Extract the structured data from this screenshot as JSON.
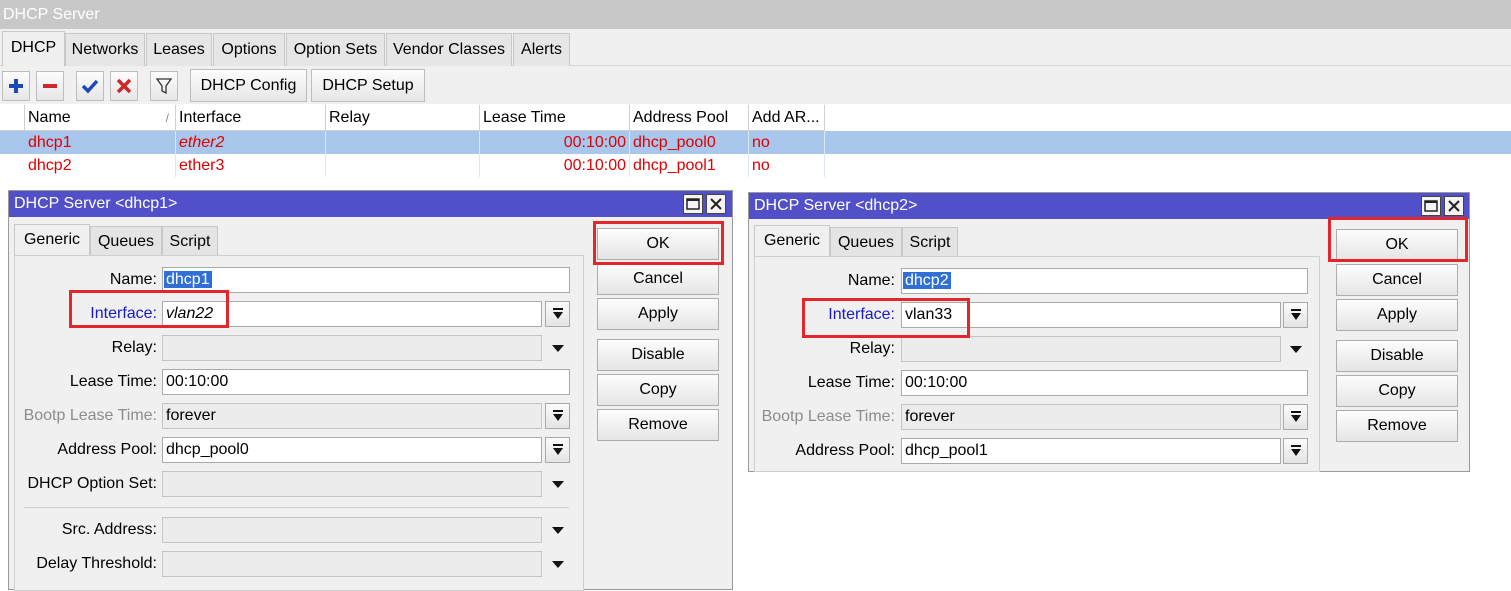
{
  "window": {
    "title": "DHCP Server"
  },
  "tabs": [
    "DHCP",
    "Networks",
    "Leases",
    "Options",
    "Option Sets",
    "Vendor Classes",
    "Alerts"
  ],
  "toolbar": {
    "dhcp_config": "DHCP Config",
    "dhcp_setup": "DHCP Setup",
    "icons": [
      "add-icon",
      "remove-icon",
      "enable-check-icon",
      "disable-x-icon",
      "filter-icon"
    ]
  },
  "table": {
    "columns": [
      "Name",
      "Interface",
      "Relay",
      "Lease Time",
      "Address Pool",
      "Add AR..."
    ],
    "rows": [
      {
        "name": "dhcp1",
        "interface": "ether2",
        "relay": "",
        "lease_time": "00:10:00",
        "address_pool": "dhcp_pool0",
        "add_arp": "no",
        "selected": true
      },
      {
        "name": "dhcp2",
        "interface": "ether3",
        "relay": "",
        "lease_time": "00:10:00",
        "address_pool": "dhcp_pool1",
        "add_arp": "no",
        "selected": false
      }
    ]
  },
  "dialogs": [
    {
      "title": "DHCP Server <dhcp1>",
      "tabs": [
        "Generic",
        "Queues",
        "Script"
      ],
      "labels": {
        "name": "Name:",
        "interface": "Interface:",
        "relay": "Relay:",
        "lease_time": "Lease Time:",
        "bootp": "Bootp Lease Time:",
        "address_pool": "Address Pool:",
        "option_set": "DHCP Option Set:",
        "src_address": "Src. Address:",
        "delay": "Delay Threshold:"
      },
      "values": {
        "name": "dhcp1",
        "interface": "vlan22",
        "relay": "",
        "lease_time": "00:10:00",
        "bootp": "forever",
        "address_pool": "dhcp_pool0",
        "option_set": "",
        "src_address": "",
        "delay": ""
      },
      "buttons": [
        "OK",
        "Cancel",
        "Apply",
        "Disable",
        "Copy",
        "Remove"
      ]
    },
    {
      "title": "DHCP Server <dhcp2>",
      "tabs": [
        "Generic",
        "Queues",
        "Script"
      ],
      "labels": {
        "name": "Name:",
        "interface": "Interface:",
        "relay": "Relay:",
        "lease_time": "Lease Time:",
        "bootp": "Bootp Lease Time:",
        "address_pool": "Address Pool:"
      },
      "values": {
        "name": "dhcp2",
        "interface": "vlan33",
        "relay": "",
        "lease_time": "00:10:00",
        "bootp": "forever",
        "address_pool": "dhcp_pool1"
      },
      "buttons": [
        "OK",
        "Cancel",
        "Apply",
        "Disable",
        "Copy",
        "Remove"
      ]
    }
  ],
  "colors": {
    "title_bar": "#5150c9",
    "selected_row": "#a9c6ec",
    "highlight_box": "#e2262a",
    "row_text": "#e00000",
    "link_label": "#1919c8"
  }
}
